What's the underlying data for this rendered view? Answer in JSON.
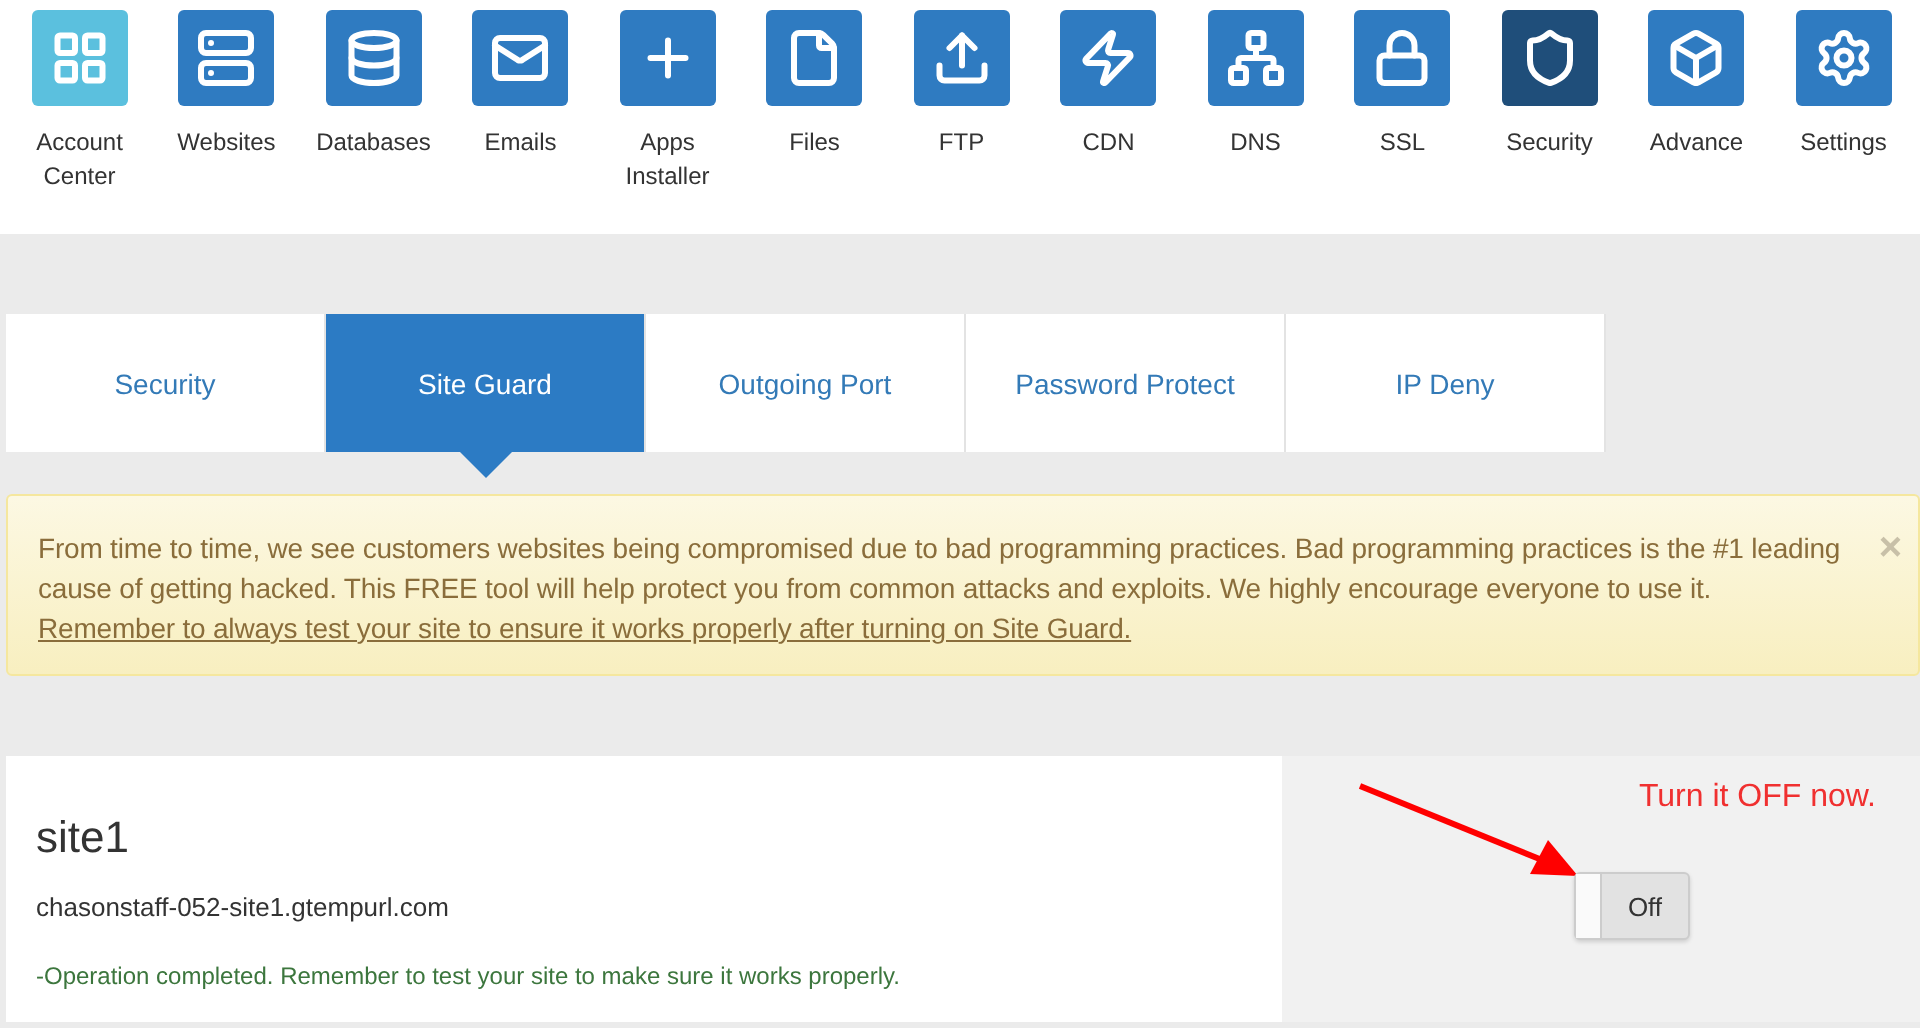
{
  "nav": [
    {
      "label": "Account Center",
      "selected": false
    },
    {
      "label": "Websites",
      "selected": false
    },
    {
      "label": "Databases",
      "selected": false
    },
    {
      "label": "Emails",
      "selected": false
    },
    {
      "label": "Apps Installer",
      "selected": false
    },
    {
      "label": "Files",
      "selected": false
    },
    {
      "label": "FTP",
      "selected": false
    },
    {
      "label": "CDN",
      "selected": false
    },
    {
      "label": "DNS",
      "selected": false
    },
    {
      "label": "SSL",
      "selected": false
    },
    {
      "label": "Security",
      "selected": true
    },
    {
      "label": "Advance",
      "selected": false
    },
    {
      "label": "Settings",
      "selected": false
    }
  ],
  "tabs": [
    {
      "label": "Security",
      "selected": false
    },
    {
      "label": "Site Guard",
      "selected": true
    },
    {
      "label": "Outgoing Port",
      "selected": false
    },
    {
      "label": "Password Protect",
      "selected": false
    },
    {
      "label": "IP Deny",
      "selected": false
    }
  ],
  "alert": {
    "text": "From time to time, we see customers websites being compromised due to bad programming practices. Bad programming practices is the #1 leading cause of getting hacked. This FREE tool will help protect you from common attacks and exploits. We highly encourage everyone to use it.",
    "link": "Remember to always test your site to ensure it works properly after turning on Site Guard.",
    "close": "×"
  },
  "site": {
    "name": "site1",
    "domain": "chasonstaff-052-site1.gtempurl.com",
    "status": "-Operation completed. Remember to test your site to make sure it works properly."
  },
  "annotation": "Turn it OFF now.",
  "toggle": {
    "label": "Off",
    "on": false
  }
}
